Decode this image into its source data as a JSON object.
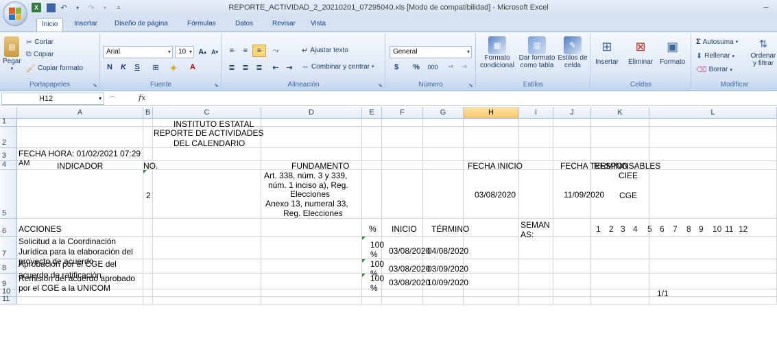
{
  "window": {
    "title": "REPORTE_ACTIVIDAD_2_20210201_07295040.xls  [Modo de compatibilidad] - Microsoft Excel",
    "minimize": "–"
  },
  "tabs": [
    "Inicio",
    "Insertar",
    "Diseño de página",
    "Fórmulas",
    "Datos",
    "Revisar",
    "Vista"
  ],
  "ribbon": {
    "portapapeles": {
      "paste": "Pegar",
      "cut": "Cortar",
      "copy": "Copiar",
      "format_painter": "Copiar formato",
      "label": "Portapapeles"
    },
    "fuente": {
      "font": "Arial",
      "size": "10",
      "bold": "N",
      "italic": "K",
      "underline": "S",
      "label": "Fuente"
    },
    "alineacion": {
      "wrap": "Ajustar texto",
      "merge": "Combinar y centrar",
      "label": "Alineación"
    },
    "numero": {
      "format": "General",
      "currency": "$",
      "percent": "%",
      "thousands": "000",
      "label": "Número"
    },
    "estilos": {
      "cond": "Formato condicional",
      "table": "Dar formato como tabla",
      "cell": "Estilos de celda",
      "label": "Estilos"
    },
    "celdas": {
      "insert": "Insertar",
      "delete": "Eliminar",
      "format": "Formato",
      "label": "Celdas"
    },
    "modificar": {
      "autosum": "Autosuma",
      "fill": "Rellenar",
      "clear": "Borrar",
      "sort": "Ordenar y filtrar",
      "label": "Modificar"
    }
  },
  "formula": {
    "namebox": "H12",
    "fx": "fx",
    "value": ""
  },
  "columns": [
    "A",
    "B",
    "C",
    "D",
    "E",
    "F",
    "G",
    "H",
    "I",
    "J",
    "K",
    "L"
  ],
  "rows": [
    "1",
    "2",
    "3",
    "4",
    "5",
    "6",
    "7",
    "8",
    "9",
    "10",
    "11"
  ],
  "cells": {
    "C1": "INSTITUTO ESTATAL",
    "C2a": "REPORTE DE ACTIVIDADES",
    "C2b": "DEL CALENDARIO",
    "A3a": "FECHA HORA: 01/02/2021 07:29",
    "A3b": "AM",
    "A4": "INDICADOR",
    "B4": "NO.",
    "D4": "FUNDAMENTO",
    "H4": "FECHA INICIO",
    "J4": "FECHA TERMINO",
    "K4": "RESPONSABLES",
    "B5": "2",
    "D5a": "Art. 338, núm. 3 y 339,",
    "D5b": "núm. 1 inciso a), Reg.",
    "D5c": "Elecciones",
    "D5d": "Anexo 13, numeral 33,",
    "D5e": "Reg. Elecciones",
    "H5": "03/08/2020",
    "J5": "11/09/2020",
    "K5a": "CIEE",
    "K5b": "CGE",
    "A6": "ACCIONES",
    "E6": "%",
    "F6": "INICIO",
    "G6": "TÉRMINO",
    "I6a": "SEMAN",
    "I6b": "AS:",
    "weeks": [
      "1",
      "2",
      "3",
      "4",
      "5",
      "6",
      "7",
      "8",
      "9",
      "10",
      "11",
      "12"
    ],
    "A7a": "Solicitud a la Coordinación",
    "A7b": "Jurídica para la elaboración del",
    "A7c": "proyecto de acuerdo",
    "E7a": "100",
    "E7b": "%",
    "F7": "03/08/2020",
    "G7": "04/08/2020",
    "A8a": "Aprobación por el CGE del",
    "A8b": "acuerdo de ratificación",
    "E8a": "100",
    "E8b": "%",
    "F8": "03/08/2020",
    "G8": "03/09/2020",
    "A9a": "Remisión del acuerdo aprobado",
    "A9b": "por el CGE a la UNICOM",
    "E9a": "100",
    "E9b": "%",
    "F9": "03/08/2020",
    "G9": "10/09/2020",
    "K10": "1/1"
  }
}
